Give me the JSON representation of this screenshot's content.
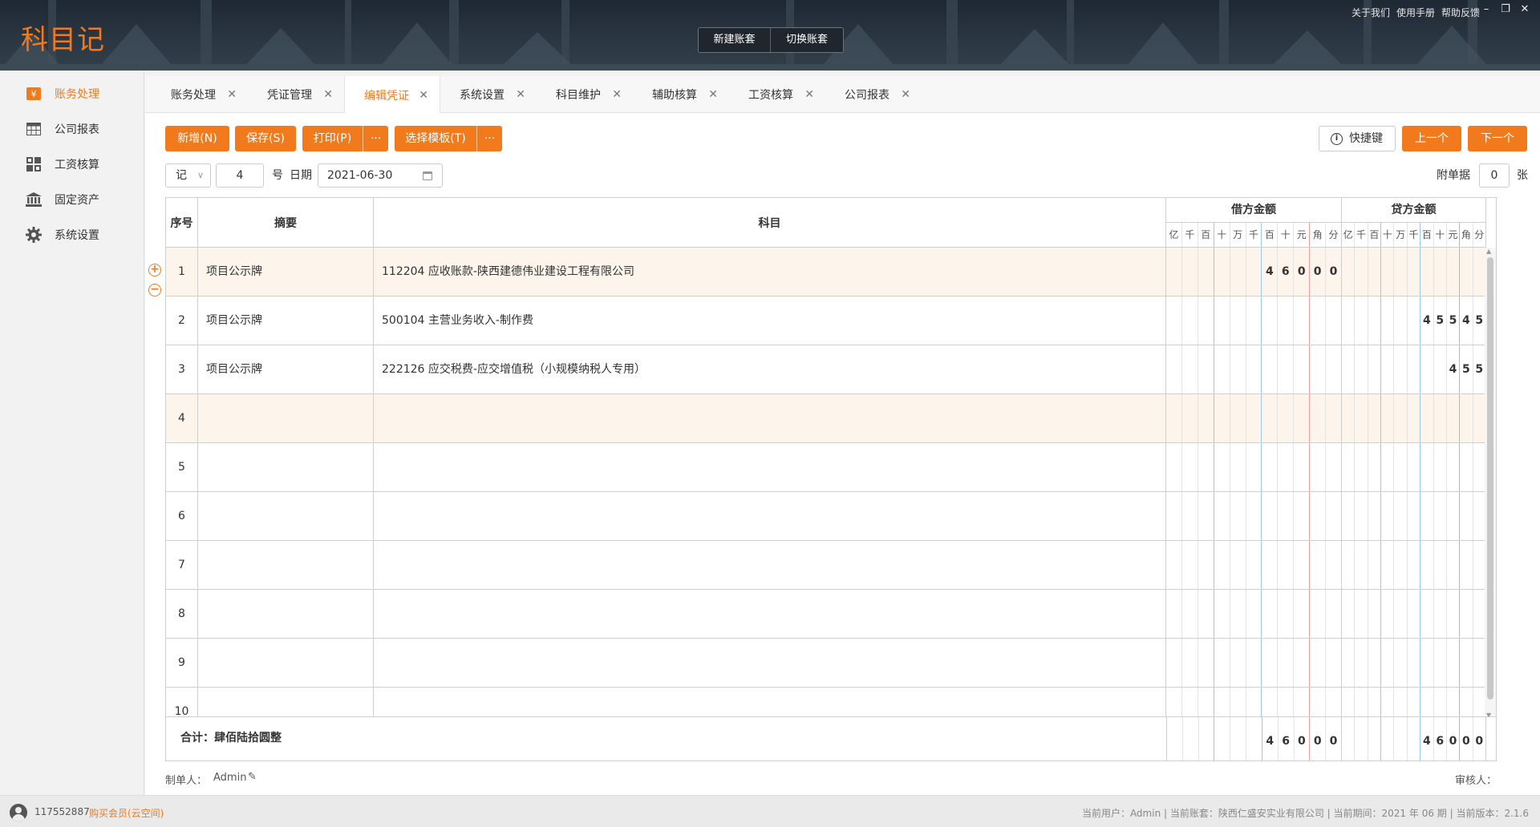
{
  "app": {
    "logo": "科目记",
    "header_buttons": [
      "新建账套",
      "切换账套"
    ],
    "header_links": [
      "关于我们",
      "使用手册",
      "帮助反馈"
    ]
  },
  "sidebar": {
    "items": [
      {
        "label": "账务处理",
        "icon": "yuan-icon",
        "active": true
      },
      {
        "label": "公司报表",
        "icon": "table-icon"
      },
      {
        "label": "工资核算",
        "icon": "grid-icon"
      },
      {
        "label": "固定资产",
        "icon": "bank-icon"
      },
      {
        "label": "系统设置",
        "icon": "gear-icon"
      }
    ]
  },
  "tabs": [
    {
      "label": "账务处理"
    },
    {
      "label": "凭证管理"
    },
    {
      "label": "编辑凭证",
      "active": true
    },
    {
      "label": "系统设置"
    },
    {
      "label": "科目维护"
    },
    {
      "label": "辅助核算"
    },
    {
      "label": "工资核算"
    },
    {
      "label": "公司报表"
    }
  ],
  "toolbar": {
    "add": "新增(N)",
    "save": "保存(S)",
    "print": "打印(P)",
    "more": "···",
    "template": "选择模板(T)",
    "shortcut": "快捷键",
    "prev": "上一个",
    "next": "下一个"
  },
  "voucher_info": {
    "type": "记",
    "number": "4",
    "number_suffix": "号",
    "date_label": "日期",
    "date": "2021-06-30",
    "attach_label": "附单据",
    "attach_count": "0",
    "attach_unit": "张"
  },
  "table": {
    "headers": {
      "seq": "序号",
      "summary": "摘要",
      "account": "科目",
      "debit": "借方金额",
      "credit": "贷方金额"
    },
    "digit_labels": [
      "亿",
      "千",
      "百",
      "十",
      "万",
      "千",
      "百",
      "十",
      "元",
      "角",
      "分"
    ],
    "rows": [
      {
        "seq": "1",
        "summary": "项目公示牌",
        "account": "112204 应收账款-陕西建德伟业建设工程有限公司",
        "debit": "46000",
        "credit": ""
      },
      {
        "seq": "2",
        "summary": "项目公示牌",
        "account": "500104 主营业务收入-制作费",
        "debit": "",
        "credit": "45545"
      },
      {
        "seq": "3",
        "summary": "项目公示牌",
        "account": "222126 应交税费-应交增值税（小规模纳税人专用）",
        "debit": "",
        "credit": "455"
      },
      {
        "seq": "4",
        "summary": "",
        "account": "",
        "debit": "",
        "credit": ""
      },
      {
        "seq": "5",
        "summary": "",
        "account": "",
        "debit": "",
        "credit": ""
      },
      {
        "seq": "6",
        "summary": "",
        "account": "",
        "debit": "",
        "credit": ""
      },
      {
        "seq": "7",
        "summary": "",
        "account": "",
        "debit": "",
        "credit": ""
      },
      {
        "seq": "8",
        "summary": "",
        "account": "",
        "debit": "",
        "credit": ""
      },
      {
        "seq": "9",
        "summary": "",
        "account": "",
        "debit": "",
        "credit": ""
      },
      {
        "seq": "10",
        "summary": "",
        "account": "",
        "debit": "",
        "credit": ""
      }
    ],
    "total_label": "合计：肆佰陆拾圆整",
    "total_debit": "46000",
    "total_credit": "46000"
  },
  "footer": {
    "maker_label": "制单人：",
    "maker": "Admin",
    "reviewer_label": "审核人："
  },
  "statusbar": {
    "user_id": "117552887",
    "buy_member": "购买会员(云空间)",
    "info": "当前用户：Admin | 当前账套：陕西仁盛安实业有限公司 | 当前期间：2021 年 06 期 | 当前版本：2.1.6"
  },
  "colors": {
    "accent": "#f07a1c",
    "header_bg": "#2a3642",
    "highlight_row": "#fdf4ec"
  }
}
